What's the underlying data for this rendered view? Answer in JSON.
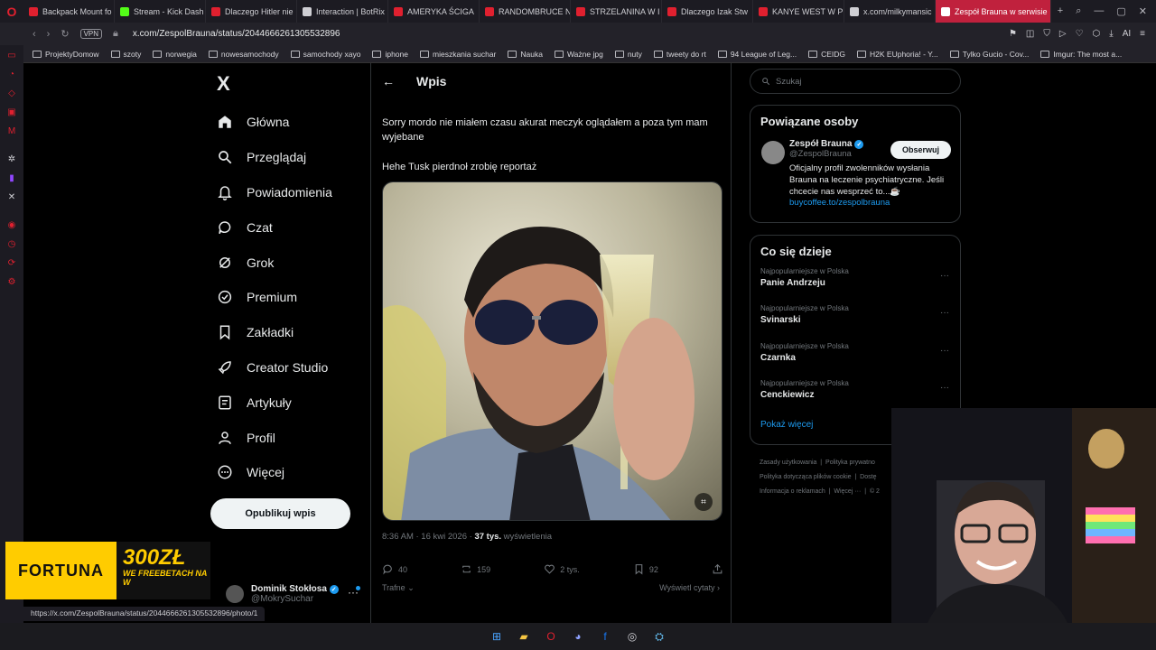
{
  "browser": {
    "tabs": [
      {
        "label": "Backpack Mount fo",
        "color": "#e0202f"
      },
      {
        "label": "Stream - Kick Dash",
        "color": "#53fc18"
      },
      {
        "label": "Dlaczego Hitler nie",
        "color": "#e0202f"
      },
      {
        "label": "Interaction | BotRix",
        "color": "#cfcfd4"
      },
      {
        "label": "AMERYKA ŚCIGA",
        "color": "#e0202f"
      },
      {
        "label": "RANDOMBRUCE N",
        "color": "#e0202f"
      },
      {
        "label": "STRZELANINA W I",
        "color": "#e0202f"
      },
      {
        "label": "Dlaczego Izak Stw",
        "color": "#e0202f"
      },
      {
        "label": "KANYE WEST W P",
        "color": "#e0202f"
      },
      {
        "label": "x.com/milkymansic",
        "color": "#cfcfd4"
      },
      {
        "label": "Zespół Brauna w serwisie",
        "color": "#ffffff"
      }
    ],
    "active_tab_index": 10,
    "url": "x.com/ZespolBrauna/status/2044666261305532896",
    "vpn_label": "VPN",
    "bookmarks": [
      "ProjektyDomow",
      "szoty",
      "norwegia",
      "nowesamochody",
      "samochody xayo",
      "iphone",
      "mieszkania suchar",
      "Nauka",
      "Ważne jpg",
      "nuty",
      "tweety do rt",
      "94 League of Leg...",
      "CEIDG",
      "H2K EUphoria! - Y...",
      "Tylko Gucio - Cov...",
      "Imgur: The most a..."
    ],
    "status_url": "https://x.com/ZespolBrauna/status/2044666261305532896/photo/1",
    "ai_label": "AI"
  },
  "xnav": {
    "logo": "X",
    "items": [
      {
        "label": "Główna",
        "icon": "home-icon"
      },
      {
        "label": "Przeglądaj",
        "icon": "search-icon"
      },
      {
        "label": "Powiadomienia",
        "icon": "bell-icon"
      },
      {
        "label": "Czat",
        "icon": "chat-icon"
      },
      {
        "label": "Grok",
        "icon": "grok-icon"
      },
      {
        "label": "Premium",
        "icon": "premium-icon"
      },
      {
        "label": "Zakładki",
        "icon": "bookmark-icon"
      },
      {
        "label": "Creator Studio",
        "icon": "rocket-icon"
      },
      {
        "label": "Artykuły",
        "icon": "article-icon"
      },
      {
        "label": "Profil",
        "icon": "profile-icon"
      },
      {
        "label": "Więcej",
        "icon": "more-icon"
      }
    ],
    "post_button": "Opublikuj wpis",
    "account": {
      "name": "Dominik Stokłosa",
      "handle": "@MokrySuchar"
    }
  },
  "ad": {
    "brand": "FORTUNA",
    "amount": "300ZŁ",
    "sub": "WE FREEBETACH NA W",
    "color": "#ffcc00"
  },
  "post": {
    "header_title": "Wpis",
    "paragraphs": [
      "Sorry mordo nie miałem czasu akurat meczyk oglądałem a poza tym mam wyjebane",
      "Hehe Tusk pierdnoł zrobię reportaż"
    ],
    "time": "8:36 AM · 16 kwi 2026 · ",
    "views_count": "37 tys.",
    "views_label": " wyświetlenia",
    "replies": "40",
    "reposts": "159",
    "likes": "2 tys.",
    "bookmarks": "92",
    "sort_label": "Trafne",
    "quotes_label": "Wyświetl cytaty"
  },
  "right": {
    "search_placeholder": "Szukaj",
    "related": {
      "title": "Powiązane osoby",
      "name": "Zespół Brauna",
      "handle": "@ZespolBrauna",
      "bio": "Oficjalny profil zwolenników wysłania Brauna na leczenie psychiatryczne. Jeśli chcecie nas wesprzeć to...☕",
      "link": "buycoffee.to/zespolbrauna",
      "follow": "Obserwuj"
    },
    "trends_title": "Co się dzieje",
    "trends": [
      {
        "context": "Najpopularniejsze w Polska",
        "topic": "Panie Andrzeju"
      },
      {
        "context": "Najpopularniejsze w Polska",
        "topic": "Svinarski"
      },
      {
        "context": "Najpopularniejsze w Polska",
        "topic": "Czarnka"
      },
      {
        "context": "Najpopularniejsze w Polska",
        "topic": "Cenckiewicz"
      }
    ],
    "show_more": "Pokaż więcej",
    "footer": [
      "Zasady użytkowania",
      "Polityka prywatno",
      "Polityka dotycząca plików cookie",
      "Dostę",
      "Informacja o reklamach",
      "Więcej ···",
      "© 2"
    ]
  },
  "colors": {
    "accent": "#1d9bf0",
    "opera_red": "#e0202f",
    "active_tab": "#c0213d"
  }
}
